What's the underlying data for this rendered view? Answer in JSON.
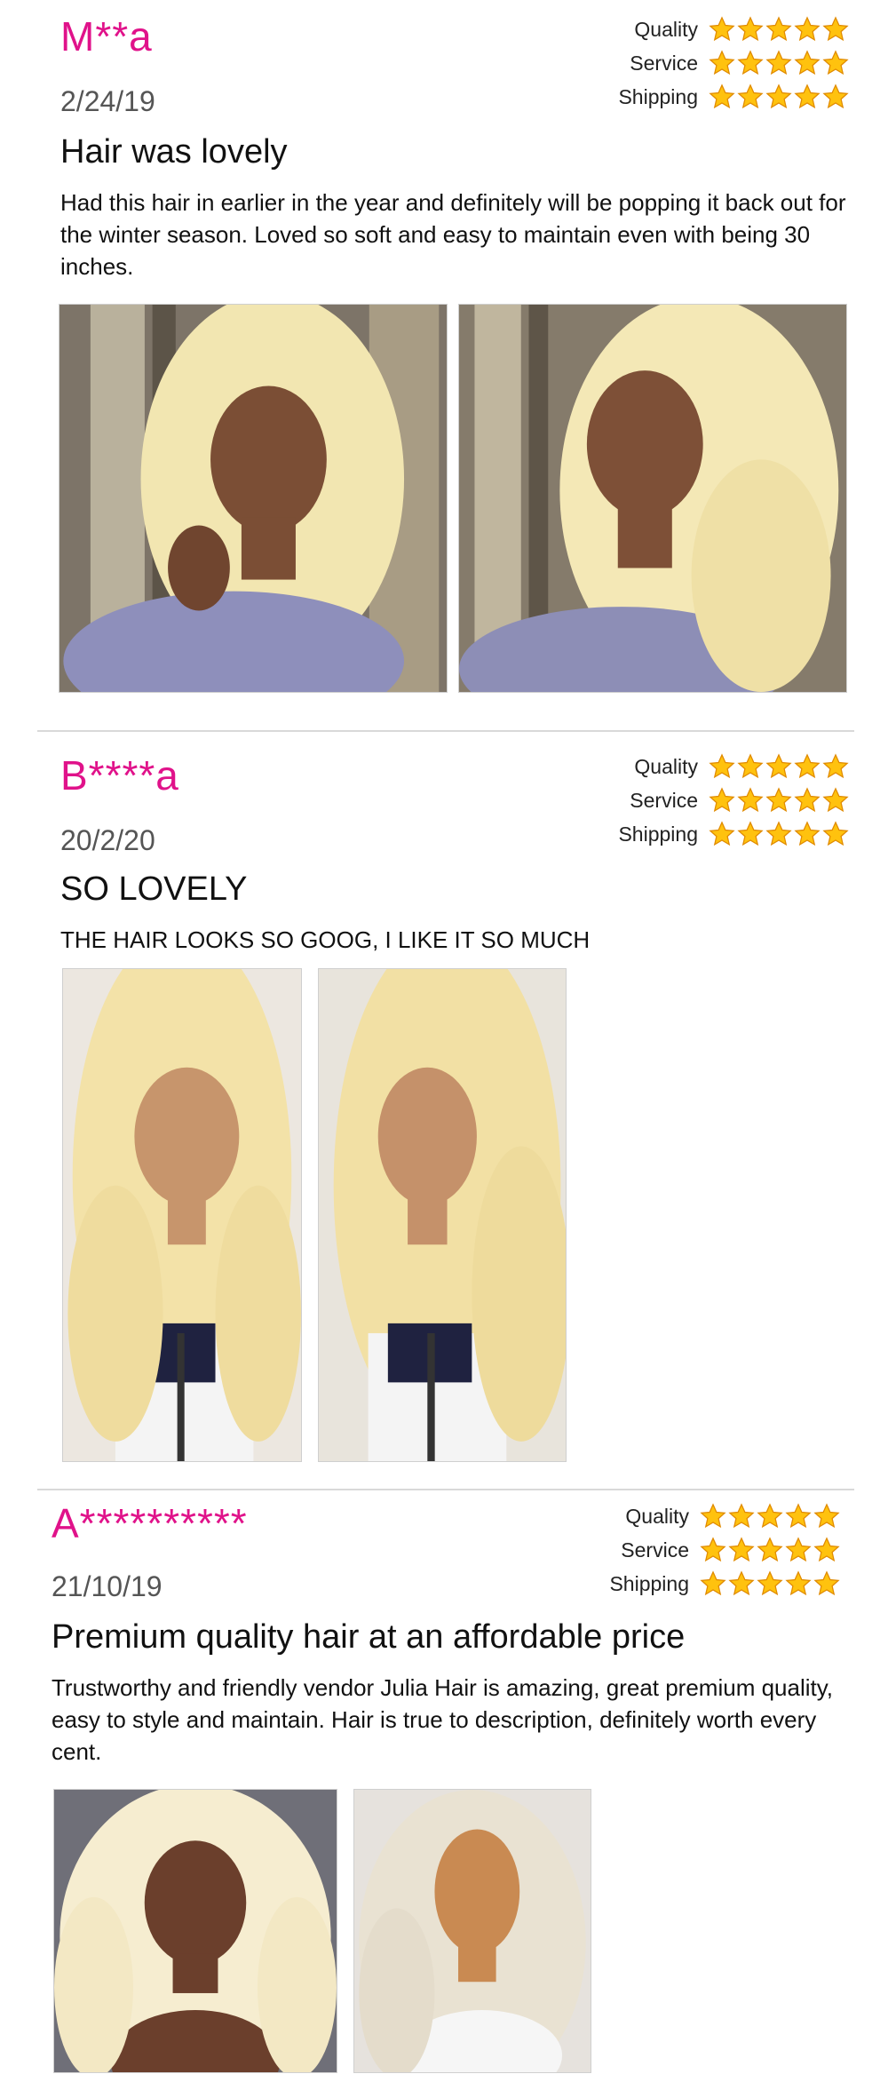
{
  "reviews": [
    {
      "reviewer": "M**a",
      "date": "2/24/19",
      "title": "Hair was lovely",
      "body": "Had this hair in earlier in the year and definitely will be popping it back out for the winter season. Loved so soft and easy to maintain even with being 30 inches.",
      "ratings": [
        {
          "label": "Quality",
          "stars": 5
        },
        {
          "label": "Service",
          "stars": 5
        },
        {
          "label": "Shipping",
          "stars": 5
        }
      ],
      "photos": [
        "customer-photo-blonde-wig-1",
        "customer-photo-blonde-wig-2"
      ]
    },
    {
      "reviewer": "B****a",
      "date": "20/2/20",
      "title": "SO LOVELY",
      "body": "THE HAIR LOOKS SO GOOG, I LIKE IT SO MUCH",
      "ratings": [
        {
          "label": "Quality",
          "stars": 5
        },
        {
          "label": "Service",
          "stars": 5
        },
        {
          "label": "Shipping",
          "stars": 5
        }
      ],
      "photos": [
        "customer-photo-blonde-wig-3",
        "customer-photo-blonde-wig-4"
      ]
    },
    {
      "reviewer": "A**********",
      "date": "21/10/19",
      "title": "Premium quality hair at an affordable price",
      "body": "Trustworthy and friendly vendor Julia Hair is amazing, great premium quality, easy to style and maintain. Hair is true to description, definitely worth every cent.",
      "ratings": [
        {
          "label": "Quality",
          "stars": 5
        },
        {
          "label": "Service",
          "stars": 5
        },
        {
          "label": "Shipping",
          "stars": 5
        }
      ],
      "photos": [
        "customer-photo-blonde-wig-5",
        "customer-photo-blonde-wig-6"
      ]
    }
  ],
  "colors": {
    "reviewer_name": "#e0128a",
    "star_fill": "#ffc20e",
    "star_stroke": "#e08a00",
    "hair": "#f3e6b0",
    "skin": "#8a5a3c",
    "divider": "#d9d9d9"
  }
}
